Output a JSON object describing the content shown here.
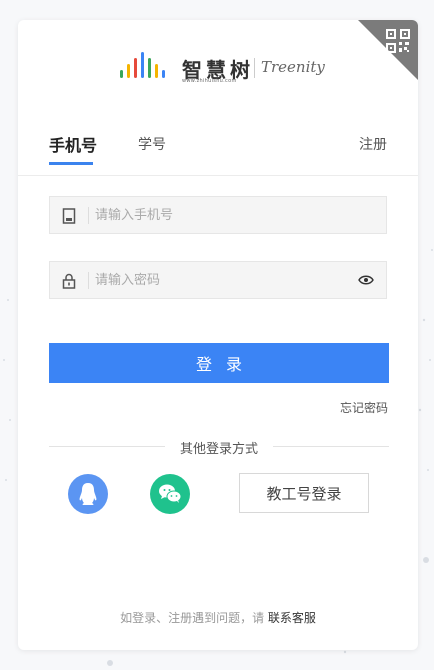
{
  "logo": {
    "cn": "智慧树",
    "url": "www.zhihuishu.com",
    "en": "Treenity",
    "bar_colors": [
      "#3aa65b",
      "#f5b400",
      "#e64a3b",
      "#3b84f5",
      "#3aa65b",
      "#f5b400",
      "#3b84f5"
    ]
  },
  "tabs": [
    {
      "label": "手机号"
    },
    {
      "label": "学号"
    }
  ],
  "register_label": "注册",
  "phone": {
    "placeholder": "请输入手机号",
    "value": ""
  },
  "password": {
    "placeholder": "请输入密码",
    "value": ""
  },
  "login_label": "登录",
  "forgot_label": "忘记密码",
  "other_methods_label": "其他登录方式",
  "staff_login_label": "教工号登录",
  "footer": {
    "text": "如登录、注册遇到问题，请 ",
    "link": "联系客服"
  },
  "colors": {
    "accent": "#3b84f5",
    "qq": "#5b95f2",
    "wechat": "#1fc28d",
    "qr_corner": "#7b7b7b"
  },
  "icons": [
    "qr-code-icon",
    "phone-icon",
    "lock-icon",
    "eye-icon",
    "qq-icon",
    "wechat-icon"
  ]
}
